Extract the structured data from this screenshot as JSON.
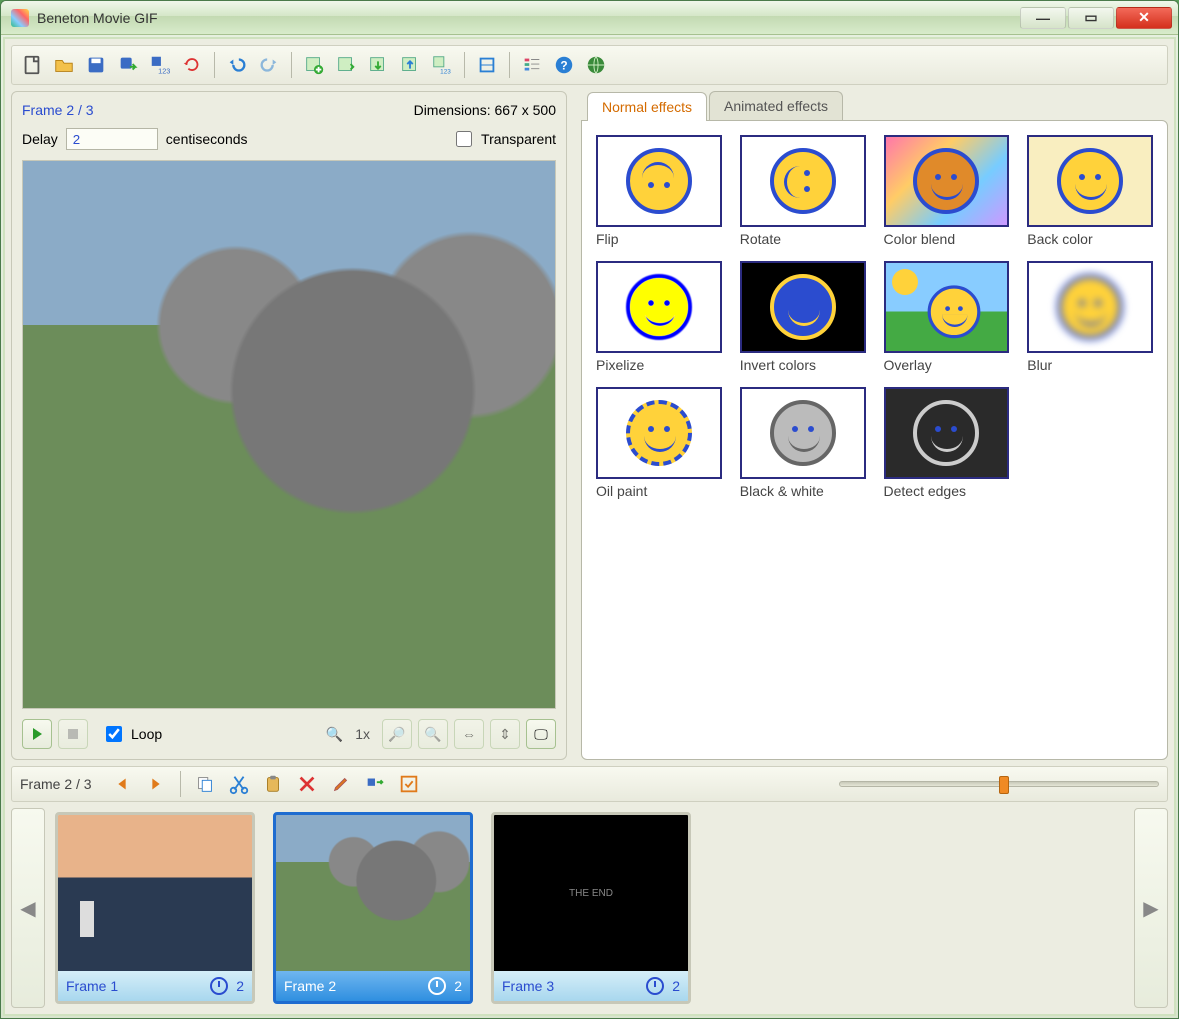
{
  "window": {
    "title": "Beneton Movie GIF"
  },
  "toolbar": {
    "buttons": [
      "new",
      "open",
      "save",
      "export",
      "export-multi",
      "reload",
      "undo",
      "redo",
      "frame-add",
      "frame-insert",
      "frame-import",
      "frame-export",
      "frame-export-multi",
      "resize",
      "properties",
      "help",
      "web"
    ]
  },
  "preview": {
    "frame_counter": "Frame 2 / 3",
    "dimensions": "Dimensions: 667 x 500",
    "delay_label": "Delay",
    "delay_value": "2",
    "delay_unit": "centiseconds",
    "transparent_label": "Transparent",
    "transparent_checked": false,
    "loop_label": "Loop",
    "loop_checked": true,
    "zoom_label": "1x"
  },
  "effects": {
    "tabs": {
      "normal": "Normal effects",
      "animated": "Animated effects",
      "active": "normal"
    },
    "items": [
      {
        "id": "flip",
        "label": "Flip"
      },
      {
        "id": "rotate",
        "label": "Rotate"
      },
      {
        "id": "color-blend",
        "label": "Color blend"
      },
      {
        "id": "back-color",
        "label": "Back color"
      },
      {
        "id": "pixelize",
        "label": "Pixelize"
      },
      {
        "id": "invert-colors",
        "label": "Invert colors"
      },
      {
        "id": "overlay",
        "label": "Overlay"
      },
      {
        "id": "blur",
        "label": "Blur"
      },
      {
        "id": "oil-paint",
        "label": "Oil paint"
      },
      {
        "id": "black-white",
        "label": "Black & white"
      },
      {
        "id": "detect-edges",
        "label": "Detect edges"
      }
    ]
  },
  "timeline": {
    "counter": "Frame 2 / 3",
    "slider_pos_pct": 50,
    "frames": [
      {
        "label": "Frame 1",
        "delay": "2",
        "selected": false
      },
      {
        "label": "Frame 2",
        "delay": "2",
        "selected": true
      },
      {
        "label": "Frame 3",
        "delay": "2",
        "selected": false
      }
    ]
  }
}
